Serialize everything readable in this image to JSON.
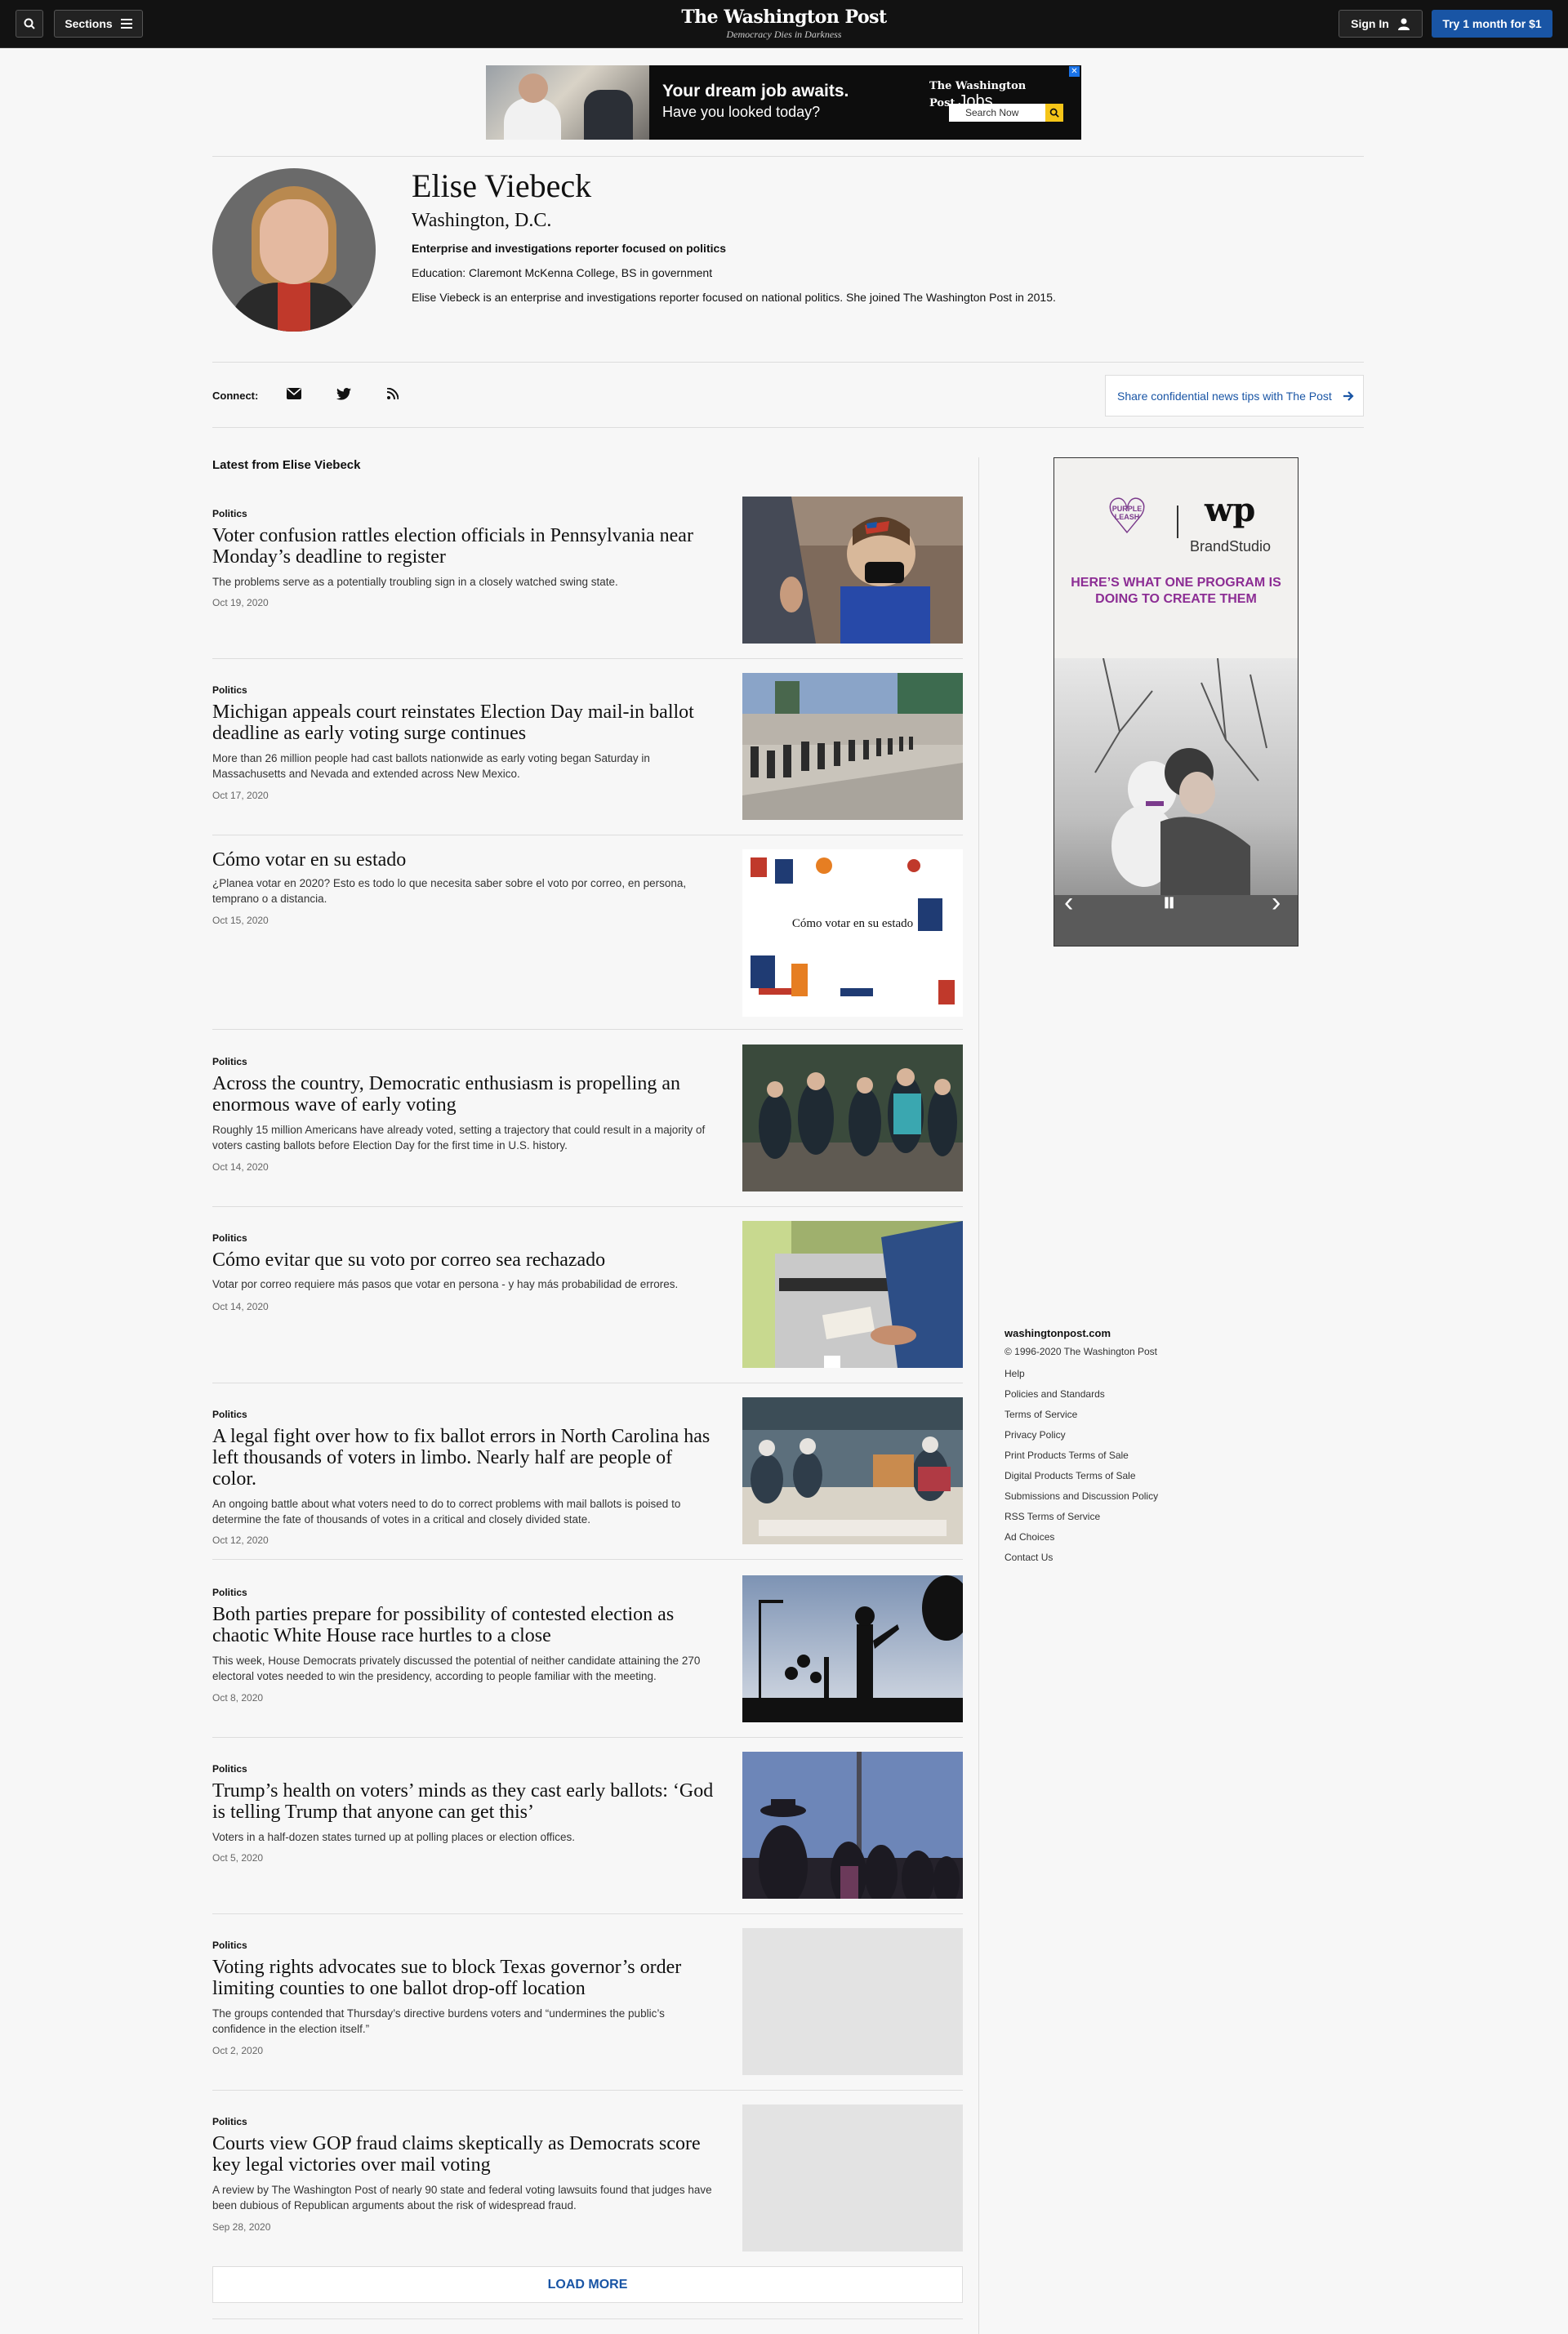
{
  "header": {
    "sections_label": "Sections",
    "logo": "The Washington Post",
    "tagline": "Democracy Dies in Darkness",
    "signin_label": "Sign In",
    "subscribe_label": "Try 1 month for $1"
  },
  "top_ad": {
    "headline": "Your dream job awaits.",
    "subline": "Have you looked today?",
    "brand": "The Washington Post",
    "brand_suffix": "Jobs",
    "search_label": "Search Now"
  },
  "profile": {
    "name": "Elise Viebeck",
    "location": "Washington, D.C.",
    "role": "Enterprise and investigations reporter focused on politics",
    "education": "Education: Claremont McKenna College, BS in government",
    "bio": "Elise Viebeck is an enterprise and investigations reporter focused on national politics. She joined The Washington Post in 2015."
  },
  "connect": {
    "label": "Connect:",
    "tips_label": "Share confidential news tips with The Post"
  },
  "latest": {
    "title": "Latest from Elise Viebeck",
    "articles": [
      {
        "kicker": "Politics",
        "headline": "Voter confusion rattles election officials in Pennsylvania near Monday’s deadline to register",
        "blurb": "The problems serve as a potentially troubling sign in a closely watched swing state.",
        "date": "Oct 19, 2020"
      },
      {
        "kicker": "Politics",
        "headline": "Michigan appeals court reinstates Election Day mail-in ballot deadline as early voting surge continues",
        "blurb": "More than 26 million people had cast ballots nationwide as early voting began Saturday in Massachusetts and Nevada and extended across New Mexico.",
        "date": "Oct 17, 2020"
      },
      {
        "kicker": "",
        "headline": "Cómo votar en su estado",
        "blurb": "¿Planea votar en 2020? Esto es todo lo que necesita saber sobre el voto por correo, en persona, temprano o a distancia.",
        "date": "Oct 15, 2020",
        "thumb_text": "Cómo votar en su estado"
      },
      {
        "kicker": "Politics",
        "headline": "Across the country, Democratic enthusiasm is propelling an enormous wave of early voting",
        "blurb": "Roughly 15 million Americans have already voted, setting a trajectory that could result in a majority of voters casting ballots before Election Day for the first time in U.S. history.",
        "date": "Oct 14, 2020"
      },
      {
        "kicker": "Politics",
        "headline": "Cómo evitar que su voto por correo sea rechazado",
        "blurb": "Votar por correo requiere más pasos que votar en persona - y hay más probabilidad de errores.",
        "date": "Oct 14, 2020"
      },
      {
        "kicker": "Politics",
        "headline": "A legal fight over how to fix ballot errors in North Carolina has left thousands of voters in limbo. Nearly half are people of color.",
        "blurb": "An ongoing battle about what voters need to do to correct problems with mail ballots is poised to determine the fate of thousands of votes in a critical and closely divided state.",
        "date": "Oct 12, 2020"
      },
      {
        "kicker": "Politics",
        "headline": "Both parties prepare for possibility of contested election as chaotic White House race hurtles to a close",
        "blurb": "This week, House Democrats privately discussed the potential of neither candidate attaining the 270 electoral votes needed to win the presidency, according to people familiar with the meeting.",
        "date": "Oct 8, 2020"
      },
      {
        "kicker": "Politics",
        "headline": "Trump’s health on voters’ minds as they cast early ballots: ‘God is telling Trump that anyone can get this’",
        "blurb": "Voters in a half-dozen states turned up at polling places or election offices.",
        "date": "Oct 5, 2020"
      },
      {
        "kicker": "Politics",
        "headline": "Voting rights advocates sue to block Texas governor’s order limiting counties to one ballot drop-off location",
        "blurb": "The groups contended that Thursday’s directive burdens voters and “undermines the public’s confidence in the election itself.”",
        "date": "Oct 2, 2020"
      },
      {
        "kicker": "Politics",
        "headline": "Courts view GOP fraud claims skeptically as Democrats score key legal victories over mail voting",
        "blurb": "A review by The Washington Post of nearly 90 state and federal voting lawsuits found that judges have been dubious of Republican arguments about the risk of widespread fraud.",
        "date": "Sep 28, 2020"
      }
    ],
    "load_more": "LOAD MORE"
  },
  "side_ad": {
    "logo_text": "PURPLE LEASH",
    "brand": "wp",
    "brand_studio": "BrandStudio",
    "pitch": "HERE’S WHAT ONE PROGRAM IS DOING TO CREATE THEM"
  },
  "footer": {
    "site": "washingtonpost.com",
    "copyright": "© 1996-2020 The Washington Post",
    "links": [
      "Help",
      "Policies and Standards",
      "Terms of Service",
      "Privacy Policy",
      "Print Products Terms of Sale",
      "Digital Products Terms of Sale",
      "Submissions and Discussion Policy",
      "RSS Terms of Service",
      "Ad Choices",
      "Contact Us"
    ]
  },
  "colors": {
    "accent": "#1955a5",
    "topbar": "#121212",
    "page_bg": "#f7f7f7",
    "ad_purple": "#8c2d94"
  }
}
